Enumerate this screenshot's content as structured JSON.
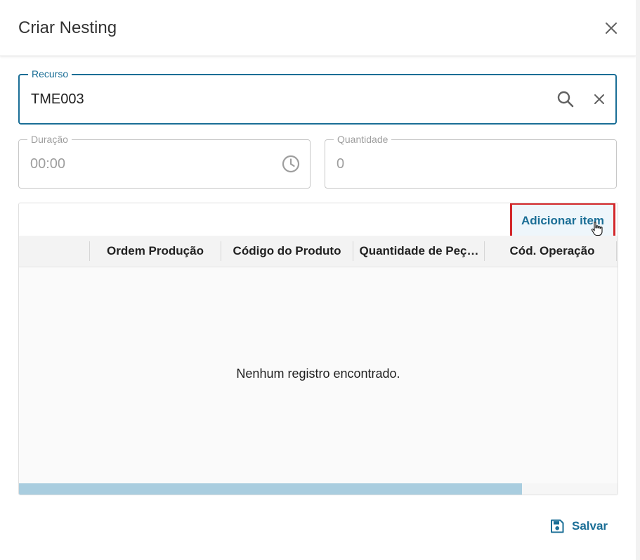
{
  "dialog": {
    "title": "Criar Nesting",
    "close_icon": "close-icon"
  },
  "recurso": {
    "label": "Recurso",
    "value": "TME003",
    "search_icon": "search-icon",
    "clear_icon": "close-icon"
  },
  "duracao": {
    "label": "Duração",
    "value": "00:00",
    "icon": "clock-icon"
  },
  "quantidade": {
    "label": "Quantidade",
    "value": "0"
  },
  "grid": {
    "add_item_label": "Adicionar item",
    "columns": [
      "",
      "Ordem Produção",
      "Código do Produto",
      "Quantidade de Peç…",
      "Cód. Operação"
    ],
    "empty_message": "Nenhum registro encontrado.",
    "scroll_position": 0.84
  },
  "footer": {
    "save_label": "Salvar",
    "save_icon": "save-icon"
  },
  "colors": {
    "accent": "#1a6e96",
    "highlight": "#d3282b"
  }
}
